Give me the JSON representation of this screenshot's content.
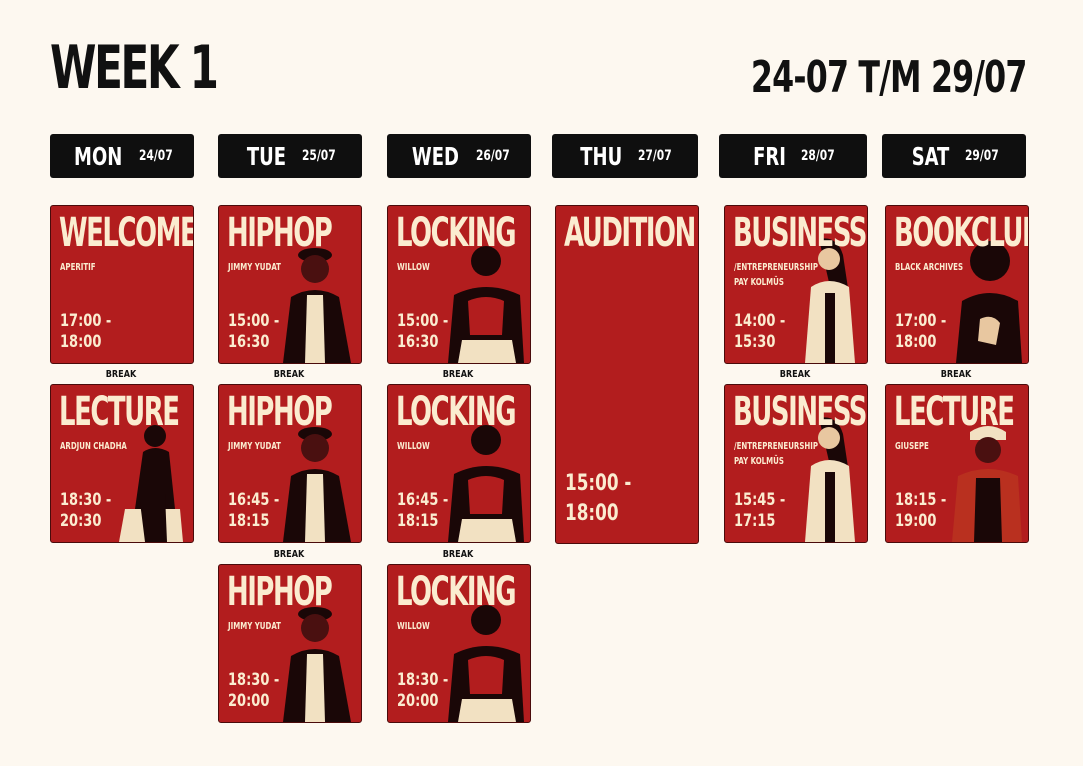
{
  "header": {
    "title": "WEEK 1",
    "range": "24-07 T/M 29/07"
  },
  "days": [
    {
      "name": "MON",
      "date": "24/07"
    },
    {
      "name": "TUE",
      "date": "25/07"
    },
    {
      "name": "WED",
      "date": "26/07"
    },
    {
      "name": "THU",
      "date": "27/07"
    },
    {
      "name": "FRI",
      "date": "28/07"
    },
    {
      "name": "SAT",
      "date": "29/07"
    }
  ],
  "break_label": "BREAK",
  "sessions": {
    "mon_1": {
      "title": "WELCOME",
      "sub": "APERITIF",
      "time": "17:00 -\n18:00"
    },
    "mon_2": {
      "title": "LECTURE",
      "sub": "ARDJUN CHADHA",
      "time": "18:30 -\n20:30"
    },
    "tue_1": {
      "title": "HIPHOP",
      "sub": "JIMMY YUDAT",
      "time": "15:00 -\n16:30"
    },
    "tue_2": {
      "title": "HIPHOP",
      "sub": "JIMMY YUDAT",
      "time": "16:45 -\n18:15"
    },
    "tue_3": {
      "title": "HIPHOP",
      "sub": "JIMMY YUDAT",
      "time": "18:30 -\n20:00"
    },
    "wed_1": {
      "title": "LOCKING",
      "sub": "WILLOW",
      "time": "15:00 -\n16:30"
    },
    "wed_2": {
      "title": "LOCKING",
      "sub": "WILLOW",
      "time": "16:45 -\n18:15"
    },
    "wed_3": {
      "title": "LOCKING",
      "sub": "WILLOW",
      "time": "18:30 -\n20:00"
    },
    "thu_1": {
      "title": "AUDITION",
      "sub": "",
      "time": "15:00 -\n18:00"
    },
    "fri_1": {
      "title": "BUSINESS",
      "sub": "/ENTREPRENEURSHIP",
      "sub2": "PAY KOLMÜS",
      "time": "14:00 -\n15:30"
    },
    "fri_2": {
      "title": "BUSINESS",
      "sub": "/ENTREPRENEURSHIP",
      "sub2": "PAY KOLMÜS",
      "time": "15:45 -\n17:15"
    },
    "sat_1": {
      "title": "BOOKCLUB",
      "sub": "BLACK ARCHIVES",
      "time": "17:00 -\n18:00"
    },
    "sat_2": {
      "title": "LECTURE",
      "sub": "GIUSEPE",
      "time": "18:15 -\n19:00"
    }
  },
  "colors": {
    "card": "#b21d1e",
    "text_on_card": "#fbecd0",
    "header_bg": "#0f0f0f",
    "page_bg": "#fdf8f0"
  }
}
